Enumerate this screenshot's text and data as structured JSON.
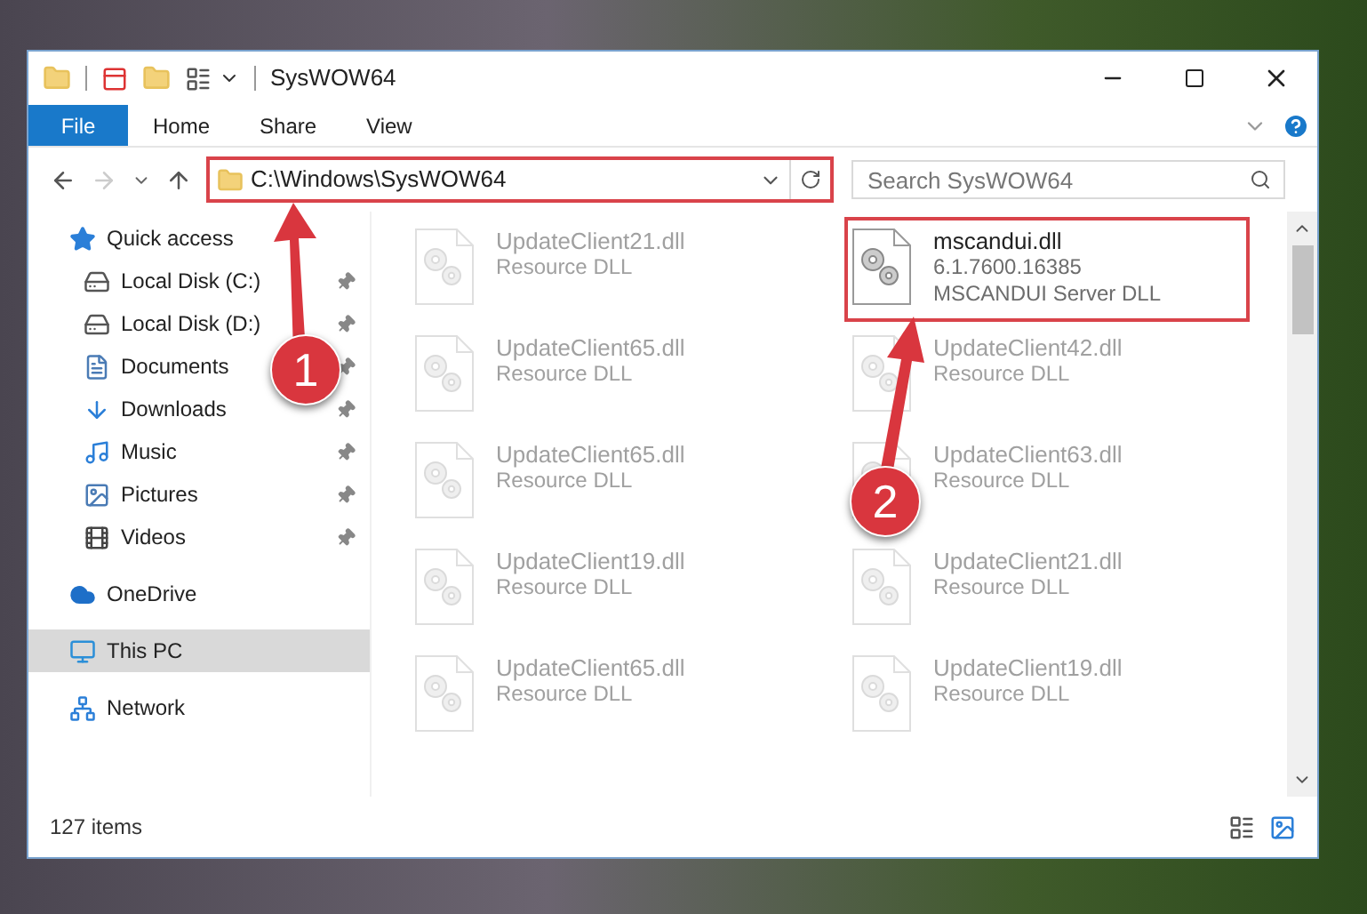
{
  "window": {
    "title": "SysWOW64"
  },
  "ribbon": {
    "file_tab": "File",
    "tabs": [
      "Home",
      "Share",
      "View"
    ]
  },
  "address_bar": {
    "path": "C:\\Windows\\SysWOW64",
    "highlighted": true
  },
  "search": {
    "placeholder": "Search SysWOW64"
  },
  "sidebar": {
    "items": [
      {
        "label": "Quick access",
        "selected": false,
        "children": [
          {
            "label": "Local Disk (C:)",
            "pinned": true,
            "selected": false
          },
          {
            "label": "Local Disk (D:)",
            "pinned": true,
            "selected": false
          },
          {
            "label": "Documents",
            "pinned": true,
            "selected": false
          },
          {
            "label": "Downloads",
            "pinned": true,
            "selected": false
          },
          {
            "label": "Music",
            "pinned": true,
            "selected": false
          },
          {
            "label": "Pictures",
            "pinned": true,
            "selected": false
          },
          {
            "label": "Videos",
            "pinned": true,
            "selected": false
          }
        ]
      },
      {
        "label": "OneDrive",
        "selected": false
      },
      {
        "label": "This PC",
        "selected": true
      },
      {
        "label": "Network",
        "selected": false
      }
    ]
  },
  "files": [
    {
      "name": "UpdateClient21.dll",
      "details": [
        "Resource DLL"
      ],
      "dimmed": true,
      "highlighted": false
    },
    {
      "name": "mscandui.dll",
      "details": [
        "6.1.7600.16385",
        "MSCANDUI Server DLL"
      ],
      "dimmed": false,
      "highlighted": true
    },
    {
      "name": "UpdateClient65.dll",
      "details": [
        "Resource DLL"
      ],
      "dimmed": true,
      "highlighted": false
    },
    {
      "name": "UpdateClient42.dll",
      "details": [
        "Resource DLL"
      ],
      "dimmed": true,
      "highlighted": false
    },
    {
      "name": "UpdateClient65.dll",
      "details": [
        "Resource DLL"
      ],
      "dimmed": true,
      "highlighted": false
    },
    {
      "name": "UpdateClient63.dll",
      "details": [
        "Resource DLL"
      ],
      "dimmed": true,
      "highlighted": false
    },
    {
      "name": "UpdateClient19.dll",
      "details": [
        "Resource DLL"
      ],
      "dimmed": true,
      "highlighted": false
    },
    {
      "name": "UpdateClient21.dll",
      "details": [
        "Resource DLL"
      ],
      "dimmed": true,
      "highlighted": false
    },
    {
      "name": "UpdateClient65.dll",
      "details": [
        "Resource DLL"
      ],
      "dimmed": true,
      "highlighted": false
    },
    {
      "name": "UpdateClient19.dll",
      "details": [
        "Resource DLL"
      ],
      "dimmed": true,
      "highlighted": false
    }
  ],
  "status_bar": {
    "item_count": "127 items"
  },
  "annotations": [
    {
      "number": "1"
    },
    {
      "number": "2"
    }
  ]
}
